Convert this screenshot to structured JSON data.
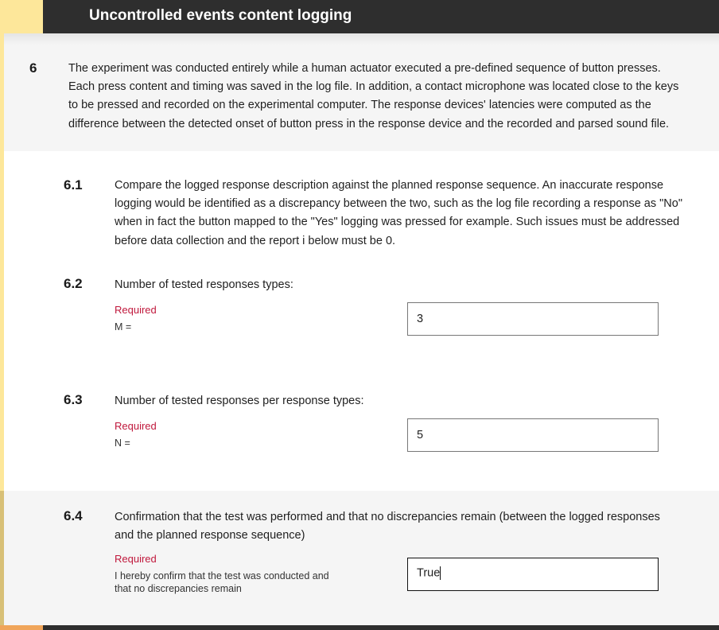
{
  "colors": {
    "stripe_yellow": "#fde79a",
    "stripe_olive": "#d8c077",
    "bottom_orange": "#f0a55a",
    "required_red": "#c0183c",
    "header_bg": "#2e2e2e"
  },
  "header": {
    "title": "Uncontrolled events content logging"
  },
  "section": {
    "number": "6",
    "intro": "The experiment was conducted entirely while a human actuator executed a pre-defined sequence of button presses. Each press content and timing was saved in the log file. In addition, a contact microphone was located close to the keys to be pressed and recorded on the experimental computer. The response devices' latencies were computed as the difference between the detected onset of button press in the response device and the recorded and parsed sound file."
  },
  "items": [
    {
      "number": "6.1",
      "text": "Compare the logged response description against the planned response sequence. An inaccurate response logging would be identified as a discrepancy between the two, such as the log file recording a response as \"No\" when in fact the button mapped to the \"Yes\" logging was pressed for example. Such issues must be addressed before data collection and the report i below must be 0."
    },
    {
      "number": "6.2",
      "text": "Number of tested responses types:",
      "required": "Required",
      "sublabel": "M =",
      "value": "3"
    },
    {
      "number": "6.3",
      "text": "Number of tested responses per response types:",
      "required": "Required",
      "sublabel": "N =",
      "value": "5"
    },
    {
      "number": "6.4",
      "text": "Confirmation that the test was performed and that no discrepancies remain (between the logged responses and the planned response sequence)",
      "required": "Required",
      "sublabel": "I hereby confirm that the test was conducted and that no discrepancies remain",
      "value": "True"
    }
  ]
}
